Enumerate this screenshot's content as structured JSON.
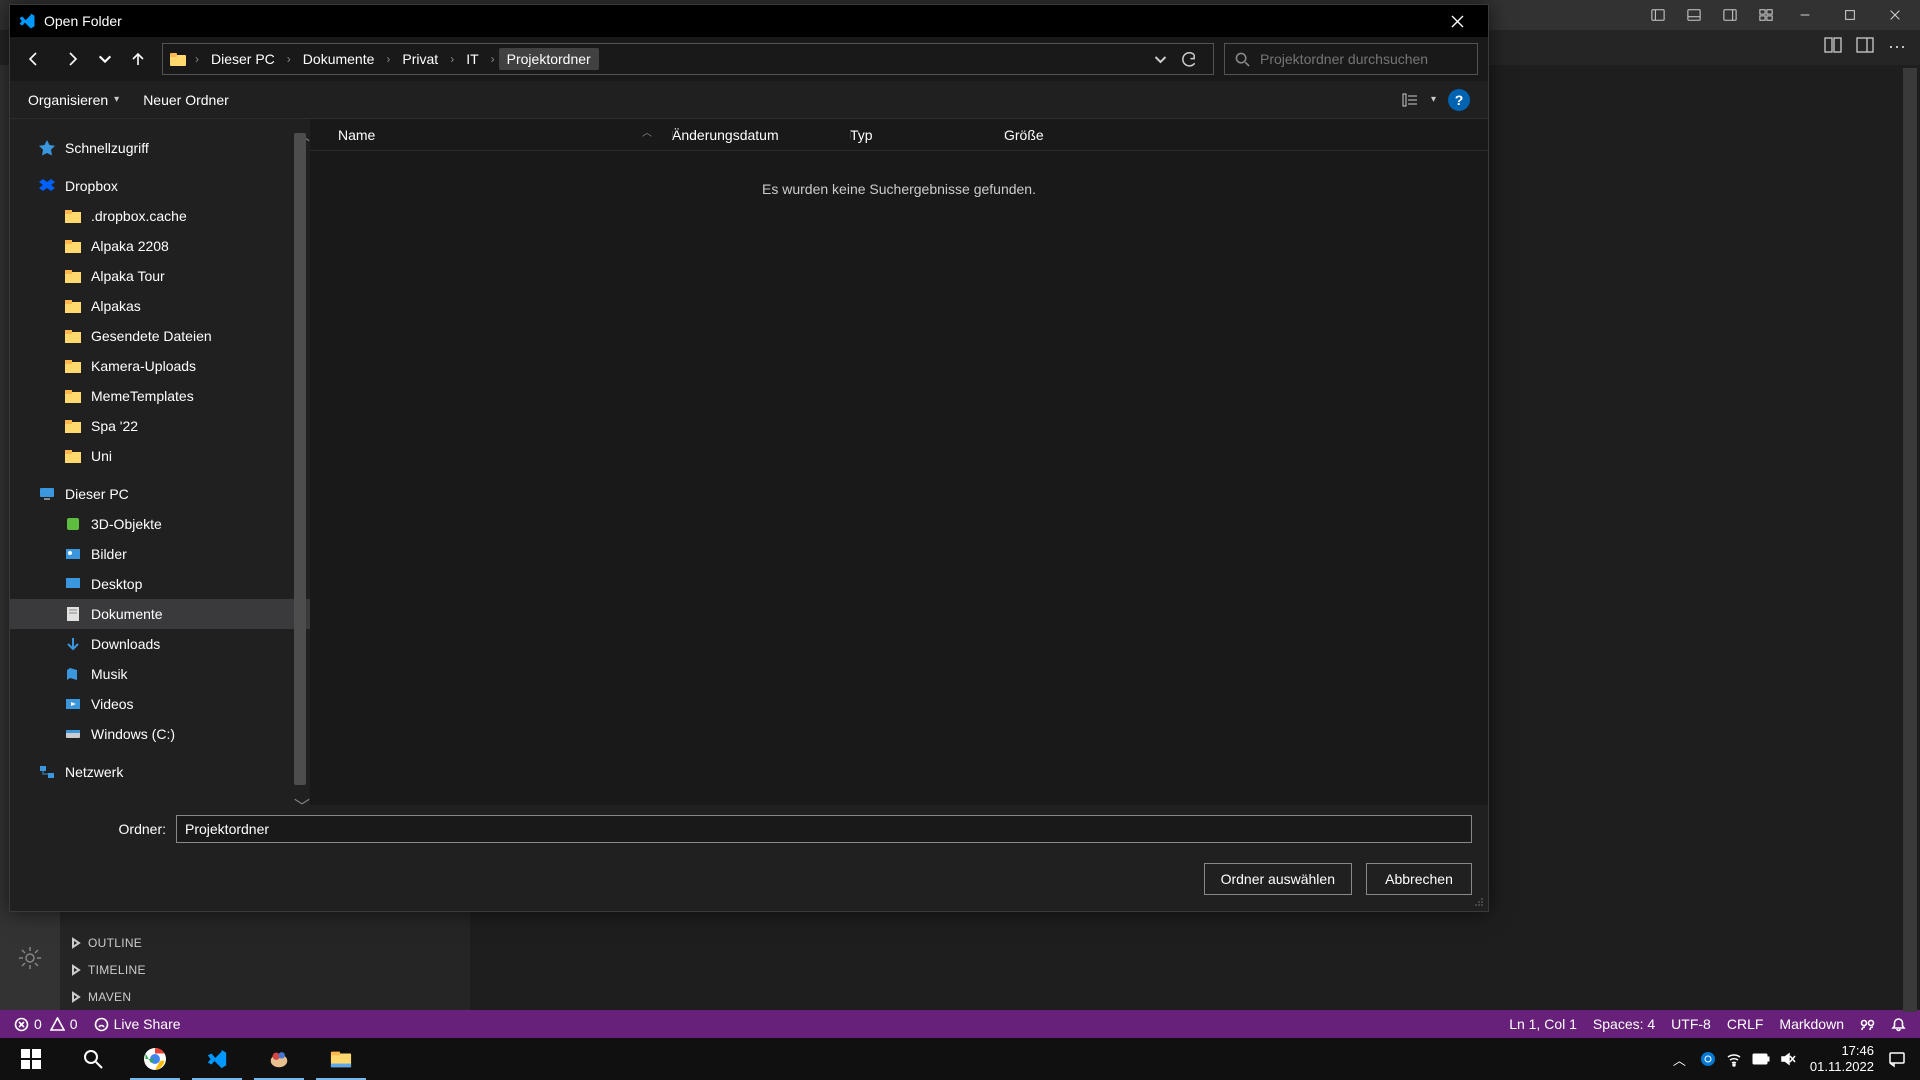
{
  "dialog": {
    "title": "Open Folder",
    "breadcrumb": [
      "Dieser PC",
      "Dokumente",
      "Privat",
      "IT",
      "Projektordner"
    ],
    "search_placeholder": "Projektordner durchsuchen",
    "organize": "Organisieren",
    "new_folder": "Neuer Ordner",
    "columns": {
      "name": "Name",
      "date": "Änderungsdatum",
      "type": "Typ",
      "size": "Größe"
    },
    "empty_message": "Es wurden keine Suchergebnisse gefunden.",
    "folder_label": "Ordner:",
    "folder_value": "Projektordner",
    "select_btn": "Ordner auswählen",
    "cancel_btn": "Abbrechen",
    "tree": {
      "quick": "Schnellzugriff",
      "dropbox": "Dropbox",
      "dropbox_items": [
        ".dropbox.cache",
        "Alpaka 2208",
        "Alpaka Tour",
        "Alpakas",
        "Gesendete Dateien",
        "Kamera-Uploads",
        "MemeTemplates",
        "Spa '22",
        "Uni"
      ],
      "this_pc": "Dieser PC",
      "pc_items": [
        "3D-Objekte",
        "Bilder",
        "Desktop",
        "Dokumente",
        "Downloads",
        "Musik",
        "Videos",
        "Windows (C:)"
      ],
      "network": "Netzwerk"
    }
  },
  "vscode": {
    "panels": {
      "outline": "OUTLINE",
      "timeline": "TIMELINE",
      "maven": "MAVEN"
    }
  },
  "statusbar": {
    "errors": "0",
    "warnings": "0",
    "liveshare": "Live Share",
    "ln": "Ln 1, Col 1",
    "spaces": "Spaces: 4",
    "enc": "UTF-8",
    "eol": "CRLF",
    "lang": "Markdown"
  },
  "taskbar": {
    "time": "17:46",
    "date": "01.11.2022"
  }
}
